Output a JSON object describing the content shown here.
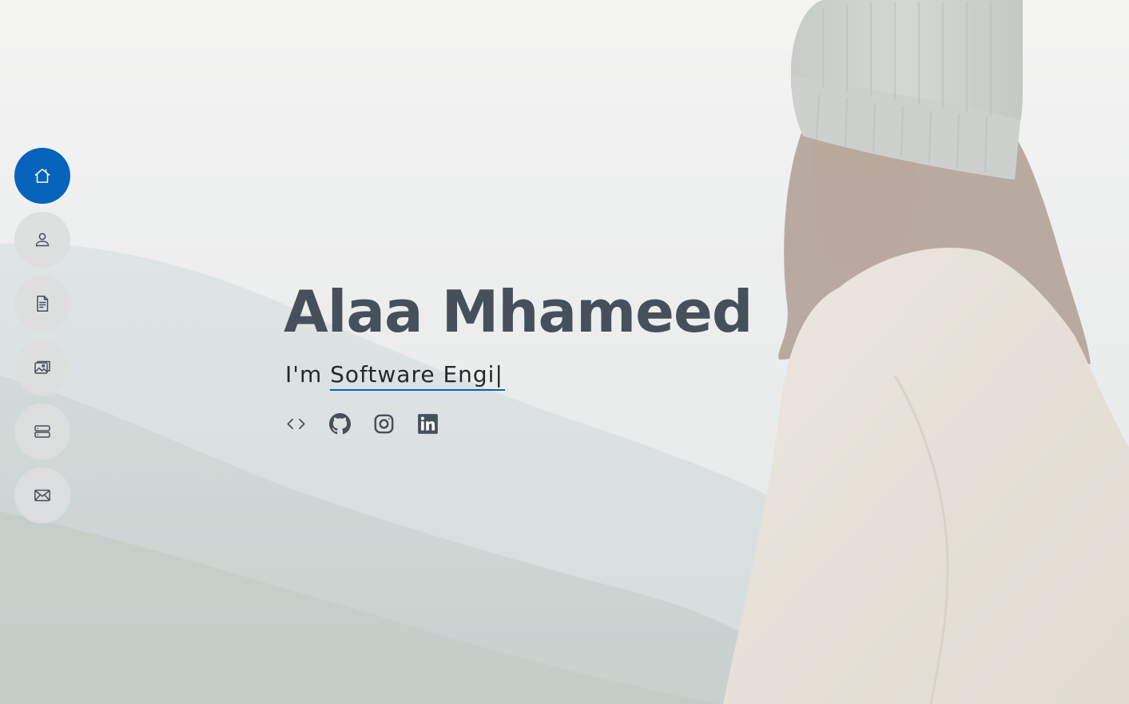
{
  "hero": {
    "name": "Alaa Mhameed",
    "tagline_prefix": "I'm ",
    "typed_text": "Software Engi",
    "cursor": "|"
  },
  "nav": {
    "items": [
      {
        "icon": "house-icon",
        "active": true
      },
      {
        "icon": "person-icon",
        "active": false
      },
      {
        "icon": "file-text-icon",
        "active": false
      },
      {
        "icon": "images-icon",
        "active": false
      },
      {
        "icon": "server-icon",
        "active": false
      },
      {
        "icon": "envelope-icon",
        "active": false
      }
    ]
  },
  "social": [
    {
      "icon": "code-icon"
    },
    {
      "icon": "github-icon"
    },
    {
      "icon": "instagram-icon"
    },
    {
      "icon": "linkedin-icon"
    }
  ],
  "colors": {
    "accent": "#0563bb",
    "heading": "#45505b",
    "text": "#272829"
  }
}
